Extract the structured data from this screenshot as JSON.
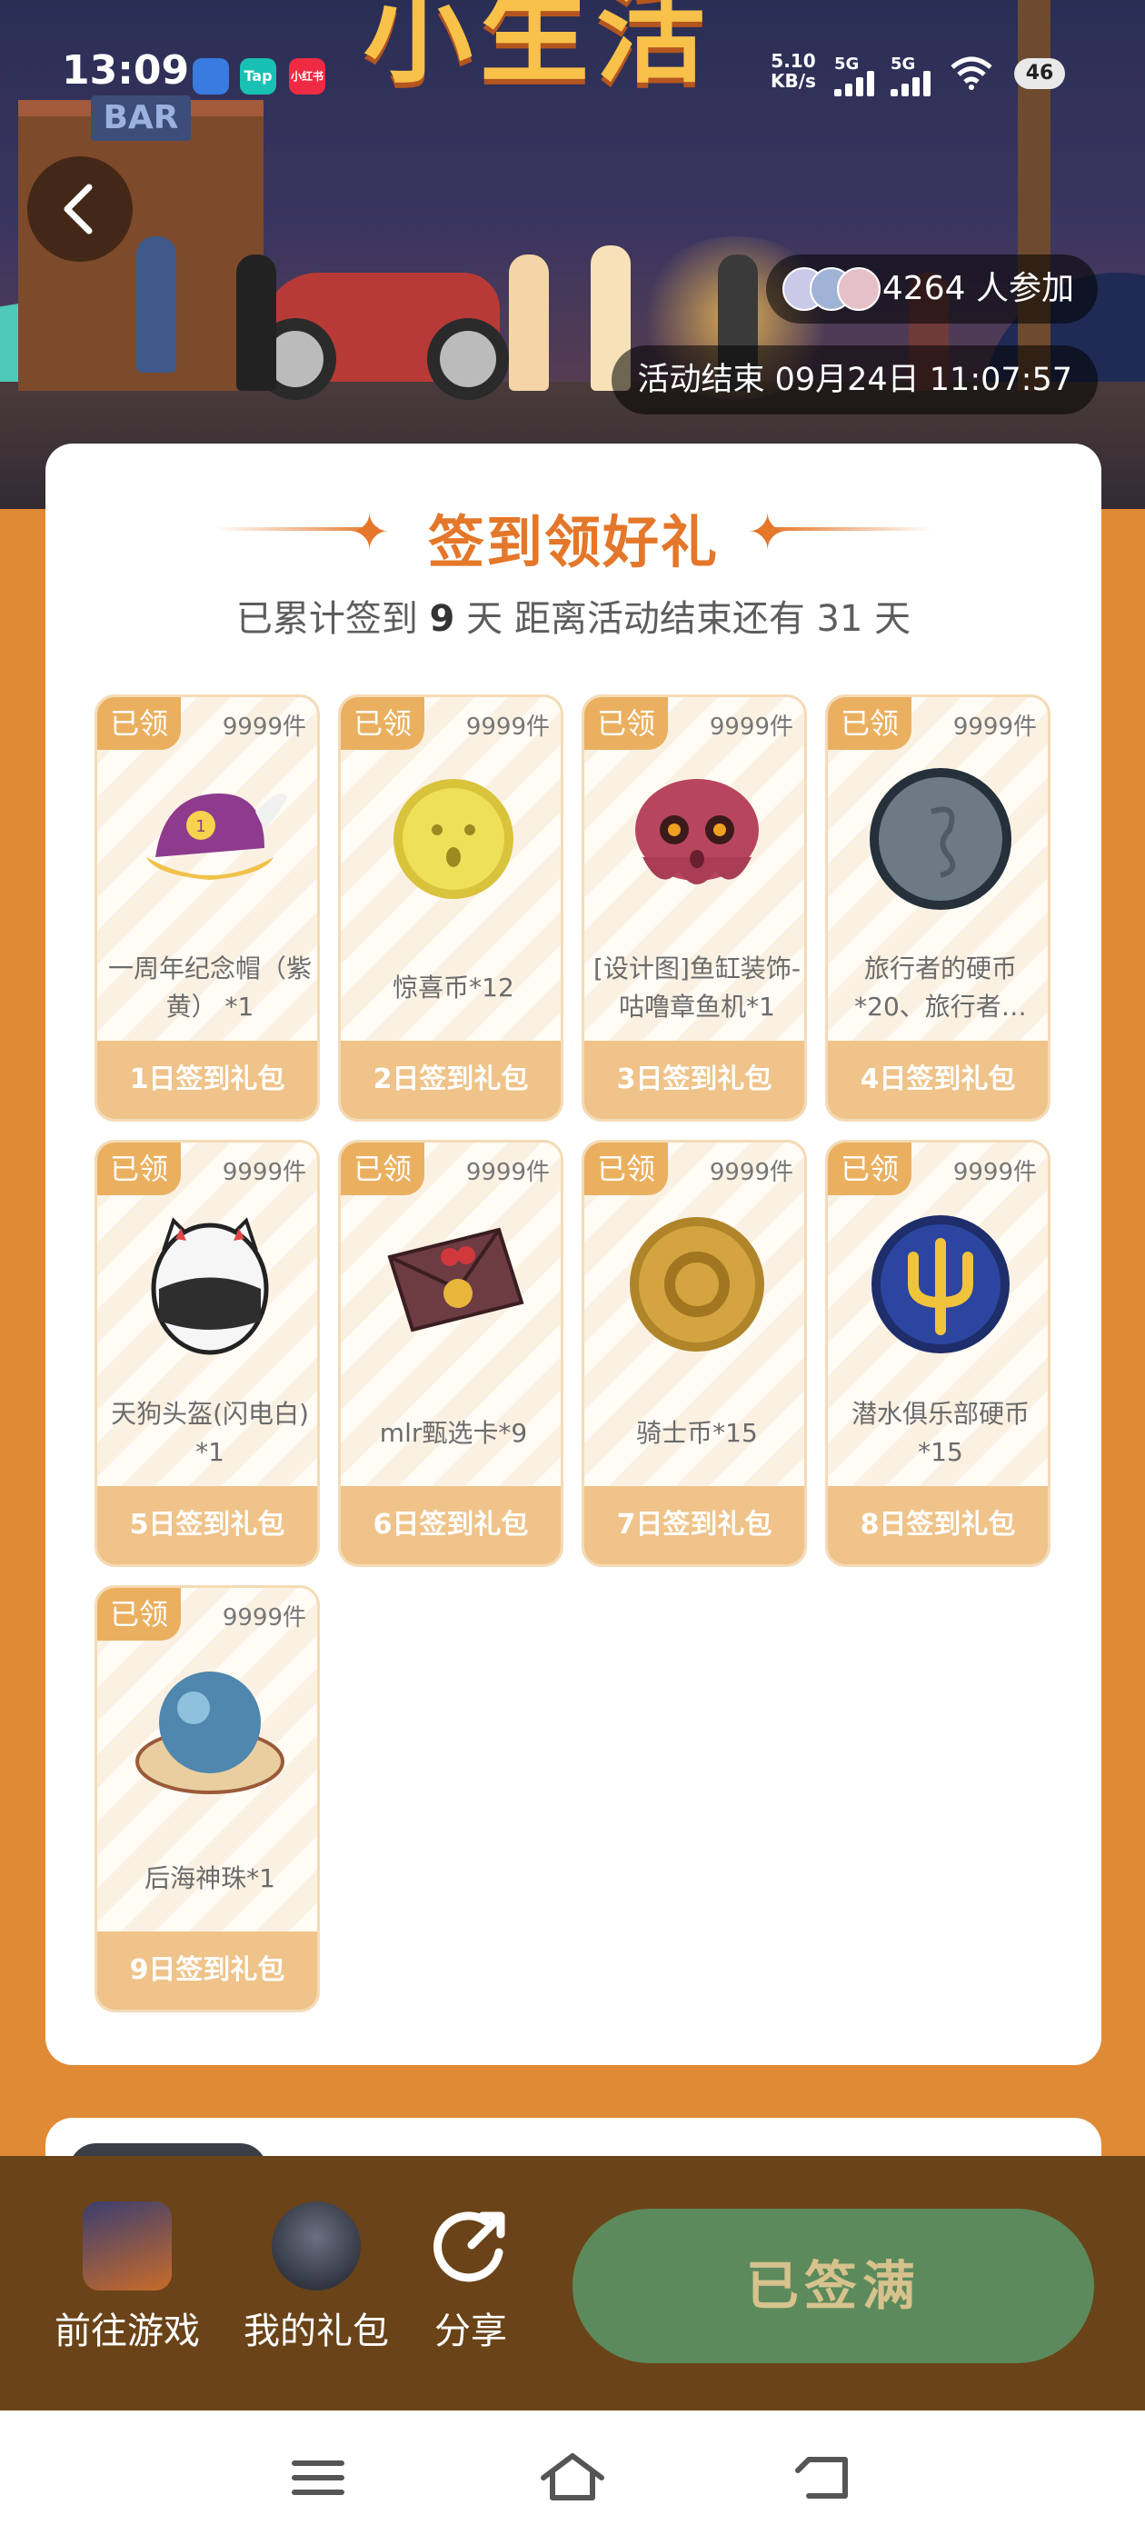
{
  "status_bar": {
    "time": "13:09",
    "app_icons": [
      {
        "name": "app-icon-blue",
        "label": "",
        "color": "#3a7be0"
      },
      {
        "name": "tap-icon",
        "label": "Tap",
        "color": "#18c1b4"
      },
      {
        "name": "xiaohongshu-icon",
        "label": "小红书",
        "color": "#ee2b43"
      }
    ],
    "net_speed_value": "5.10",
    "net_speed_unit": "KB/s",
    "sim1": "5G",
    "sim2": "5G",
    "battery": "46"
  },
  "banner": {
    "title_art": "小生活",
    "bar_sign": "BAR",
    "participants_count": "4264",
    "participants_suffix": "人参加",
    "end_label": "活动结束 09月24日 11:07:57"
  },
  "checkin": {
    "title": "签到领好礼",
    "summary_prefix": "已累计签到",
    "summary_days": "9",
    "summary_mid": "天  距离活动结束还有 31 天",
    "items": [
      {
        "tag": "已领",
        "stock": "9999件",
        "name": "一周年纪念帽（紫黄） *1",
        "day": "1日签到礼包",
        "icon": "cap-icon"
      },
      {
        "tag": "已领",
        "stock": "9999件",
        "name": "惊喜币*12",
        "day": "2日签到礼包",
        "icon": "surprise-coin-icon"
      },
      {
        "tag": "已领",
        "stock": "9999件",
        "name": "[设计图]鱼缸装饰-咕噜章鱼机*1",
        "day": "3日签到礼包",
        "icon": "octopus-icon"
      },
      {
        "tag": "已领",
        "stock": "9999件",
        "name": "旅行者的硬币*20、旅行者…",
        "day": "4日签到礼包",
        "icon": "traveler-coin-icon"
      },
      {
        "tag": "已领",
        "stock": "9999件",
        "name": "天狗头盔(闪电白) *1",
        "day": "5日签到礼包",
        "icon": "helmet-icon"
      },
      {
        "tag": "已领",
        "stock": "9999件",
        "name": "mlr甄选卡*9",
        "day": "6日签到礼包",
        "icon": "envelope-card-icon"
      },
      {
        "tag": "已领",
        "stock": "9999件",
        "name": "骑士币*15",
        "day": "7日签到礼包",
        "icon": "knight-coin-icon"
      },
      {
        "tag": "已领",
        "stock": "9999件",
        "name": "潜水俱乐部硬币*15",
        "day": "8日签到礼包",
        "icon": "trident-coin-icon"
      },
      {
        "tag": "已领",
        "stock": "9999件",
        "name": "后海神珠*1",
        "day": "9日签到礼包",
        "icon": "pearl-icon"
      }
    ]
  },
  "action_bar": {
    "go_game": "前往游戏",
    "my_gifts": "我的礼包",
    "share": "分享",
    "signed": "已签满"
  },
  "colors": {
    "accent": "#e4772a",
    "page_bg": "#e08a35",
    "tag_bg": "#eab060",
    "day_bg": "#efc389",
    "signed_btn": "#5c8a5c",
    "action_bar_bg": "#6a4318"
  }
}
